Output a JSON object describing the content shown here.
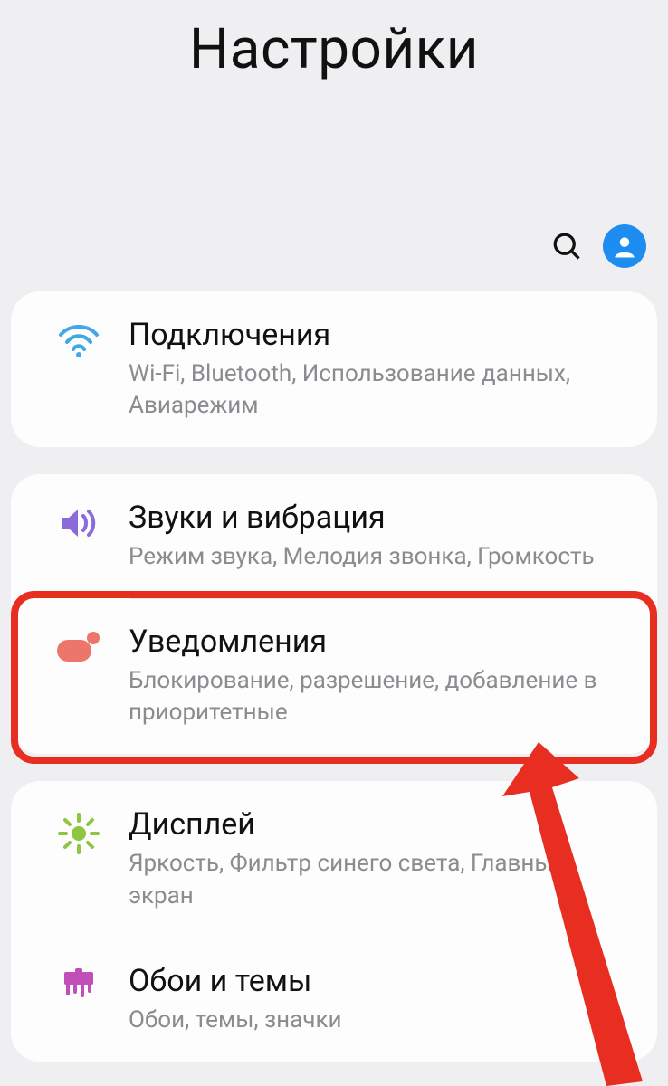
{
  "header": {
    "title": "Настройки"
  },
  "toolbar": {
    "search_icon_name": "search-icon",
    "profile_icon_name": "profile-avatar"
  },
  "groups": [
    {
      "items": [
        {
          "icon": "wifi",
          "title": "Подключения",
          "subtitle": "Wi-Fi, Bluetooth, Использование данных, Авиарежим"
        }
      ]
    },
    {
      "items": [
        {
          "icon": "sound",
          "title": "Звуки и вибрация",
          "subtitle": "Режим звука, Мелодия звонка, Громкость"
        },
        {
          "icon": "notification",
          "title": "Уведомления",
          "subtitle": "Блокирование, разрешение, добавление в приоритетные",
          "highlighted": true
        }
      ]
    },
    {
      "items": [
        {
          "icon": "display",
          "title": "Дисплей",
          "subtitle": "Яркость, Фильтр синего света, Главный экран"
        },
        {
          "icon": "wallpaper",
          "title": "Обои и темы",
          "subtitle": "Обои, темы, значки"
        }
      ]
    }
  ],
  "annotation": {
    "highlight_color": "#e82e21",
    "arrow_color": "#e82e21"
  }
}
